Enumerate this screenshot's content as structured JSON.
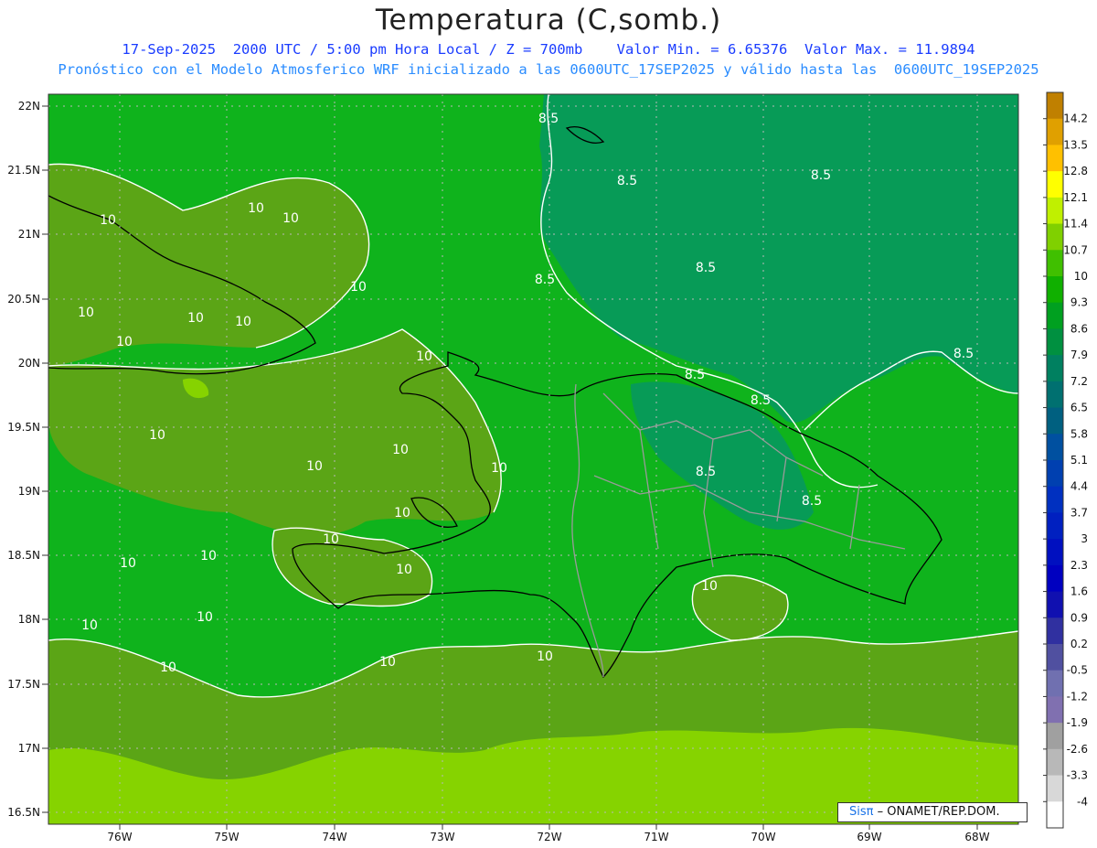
{
  "header": {
    "title": "Temperatura (C,somb.)",
    "line1": "17-Sep-2025  2000 UTC / 5:00 pm Hora Local / Z = 700mb    Valor Min. = 6.65376  Valor Max. = 11.9894",
    "line2": "Pronóstico con el Modelo Atmosferico WRF inicializado a las 0600UTC_17SEP2025 y válido hasta las  0600UTC_19SEP2025"
  },
  "map": {
    "lat_labels": [
      "22N",
      "21.5N",
      "21N",
      "20.5N",
      "20N",
      "19.5N",
      "19N",
      "18.5N",
      "18N",
      "17.5N",
      "17N",
      "16.5N"
    ],
    "lon_labels": [
      "76W",
      "75W",
      "74W",
      "73W",
      "72W",
      "71W",
      "70W",
      "69W",
      "68W"
    ],
    "contour_labels": [
      "8.5",
      "8.5",
      "8.5",
      "8.5",
      "8.5",
      "8.5",
      "8.5",
      "8.5",
      "8.5",
      "8.5",
      "10",
      "10",
      "10",
      "10",
      "10",
      "10",
      "10",
      "10",
      "10",
      "10",
      "10",
      "10",
      "10",
      "10",
      "10",
      "10",
      "10",
      "10",
      "10",
      "10",
      "10",
      "10",
      "10",
      "10"
    ],
    "colors": {
      "dark_green": "#079b57",
      "mid_green": "#0fb31c",
      "light_green": "#5ba516",
      "lime": "#86d300"
    }
  },
  "colorbar": {
    "labels": [
      "14.2",
      "13.5",
      "12.8",
      "12.1",
      "11.4",
      "10.7",
      "10",
      "9.3",
      "8.6",
      "7.9",
      "7.2",
      "6.5",
      "5.8",
      "5.1",
      "4.4",
      "3.7",
      "3",
      "2.3",
      "1.6",
      "0.9",
      "0.2",
      "-0.5",
      "-1.2",
      "-1.9",
      "-2.6",
      "-3.3",
      "-4"
    ],
    "colors": [
      "#c08000",
      "#e0a000",
      "#ffc000",
      "#ffff00",
      "#c0f000",
      "#80d000",
      "#40c000",
      "#10b000",
      "#00a020",
      "#009040",
      "#008060",
      "#007070",
      "#006080",
      "#0050a0",
      "#0040b0",
      "#0030c0",
      "#0020c0",
      "#0010c0",
      "#0000c0",
      "#1010b0",
      "#3030a0",
      "#5050a0",
      "#7070b0",
      "#8070b0",
      "#a0a0a0",
      "#b8b8b8",
      "#d8d8d8",
      "#ffffff"
    ]
  },
  "credit": {
    "brand": "Sisπ",
    "org": " – ONAMET/REP.DOM."
  }
}
